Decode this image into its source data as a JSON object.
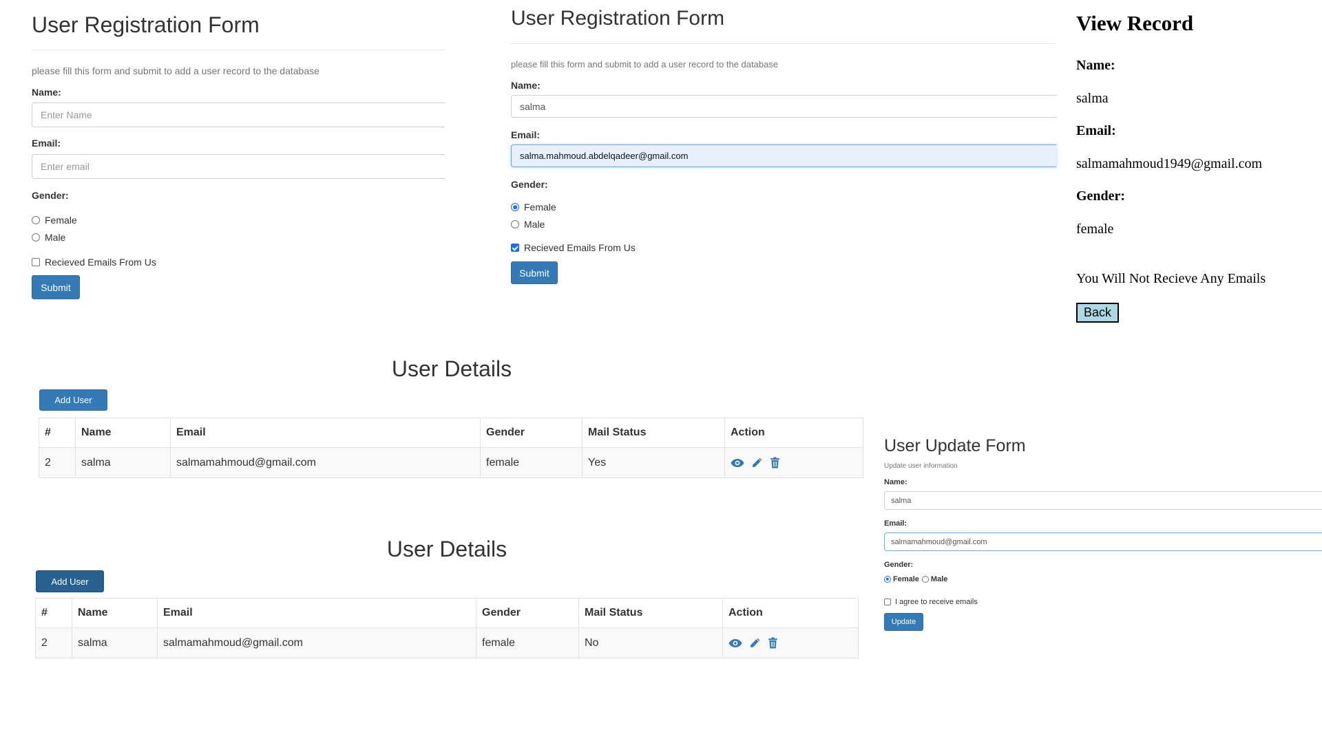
{
  "form1": {
    "title": "User Registration Form",
    "subtitle": "please fill this form and submit to add a user record to the database",
    "name_label": "Name:",
    "name_placeholder": "Enter Name",
    "email_label": "Email:",
    "email_placeholder": "Enter email",
    "gender_label": "Gender:",
    "female_label": "Female",
    "male_label": "Male",
    "emails_label": "Recieved Emails From Us",
    "submit_label": "Submit"
  },
  "form2": {
    "title": "User Registration Form",
    "subtitle": "please fill this form and submit to add a user record to the database",
    "name_label": "Name:",
    "name_value": "salma",
    "email_label": "Email:",
    "email_value": "salma.mahmoud.abdelqadeer@gmail.com",
    "gender_label": "Gender:",
    "female_label": "Female",
    "male_label": "Male",
    "emails_label": "Recieved Emails From Us",
    "submit_label": "Submit"
  },
  "view_record": {
    "title": "View Record",
    "name_label": "Name:",
    "name_value": "salma",
    "email_label": "Email:",
    "email_value": "salmamahmoud1949@gmail.com",
    "gender_label": "Gender:",
    "gender_value": "female",
    "emails_message": "You Will Not Recieve Any Emails",
    "back_label": "Back"
  },
  "details1": {
    "title": "User Details",
    "add_label": "Add User",
    "headers": [
      "#",
      "Name",
      "Email",
      "Gender",
      "Mail Status",
      "Action"
    ],
    "row": {
      "id": "2",
      "name": "salma",
      "email": "salmamahmoud@gmail.com",
      "gender": "female",
      "mail_status": "Yes"
    }
  },
  "details2": {
    "title": "User Details",
    "add_label": "Add User",
    "headers": [
      "#",
      "Name",
      "Email",
      "Gender",
      "Mail Status",
      "Action"
    ],
    "row": {
      "id": "2",
      "name": "salma",
      "email": "salmamahmoud@gmail.com",
      "gender": "female",
      "mail_status": "No"
    }
  },
  "update_form": {
    "title": "User Update Form",
    "subtitle": "Update user information",
    "name_label": "Name:",
    "name_value": "salma",
    "email_label": "Email:",
    "email_value": "salmamahmoud@gmail.com",
    "gender_label": "Gender:",
    "female_label": "Female",
    "male_label": "Male",
    "agree_label": "I agree to receive emails",
    "update_label": "Update"
  },
  "colors": {
    "primary": "#337ab7",
    "icon_blue": "#337ab7",
    "back_button": "#add8e6",
    "radio_checked": "#1a73e8"
  },
  "icons": [
    "eye-icon",
    "pencil-icon",
    "trash-icon"
  ]
}
